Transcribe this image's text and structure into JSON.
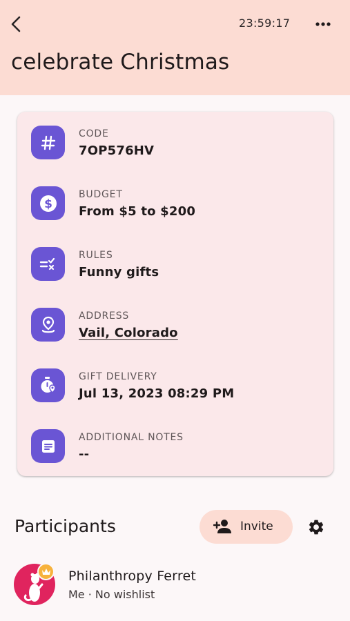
{
  "header": {
    "time": "23:59:17",
    "title": "celebrate Christmas"
  },
  "details": [
    {
      "label": "CODE",
      "value": "7OP576HV",
      "icon": "hashtag-icon"
    },
    {
      "label": "BUDGET",
      "value": "From $5 to $200",
      "icon": "dollar-icon"
    },
    {
      "label": "RULES",
      "value": "Funny gifts",
      "icon": "rules-icon"
    },
    {
      "label": "ADDRESS",
      "value": "Vail, Colorado",
      "icon": "location-pin-icon"
    },
    {
      "label": "GIFT DELIVERY",
      "value": "Jul 13, 2023 08:29 PM",
      "icon": "stopwatch-location-icon"
    },
    {
      "label": "ADDITIONAL NOTES",
      "value": "--",
      "icon": "notes-icon"
    }
  ],
  "participants": {
    "title": "Participants",
    "invite_label": "Invite",
    "items": [
      {
        "name": "Philanthropy Ferret",
        "subtitle": "Me · No wishlist"
      }
    ]
  },
  "colors": {
    "header_bg": "#fcdcd3",
    "card_bg": "#fbe8ea",
    "icon_bg": "#6a55d4",
    "avatar_bg": "#e0245e",
    "crown": "#f7b23c"
  }
}
